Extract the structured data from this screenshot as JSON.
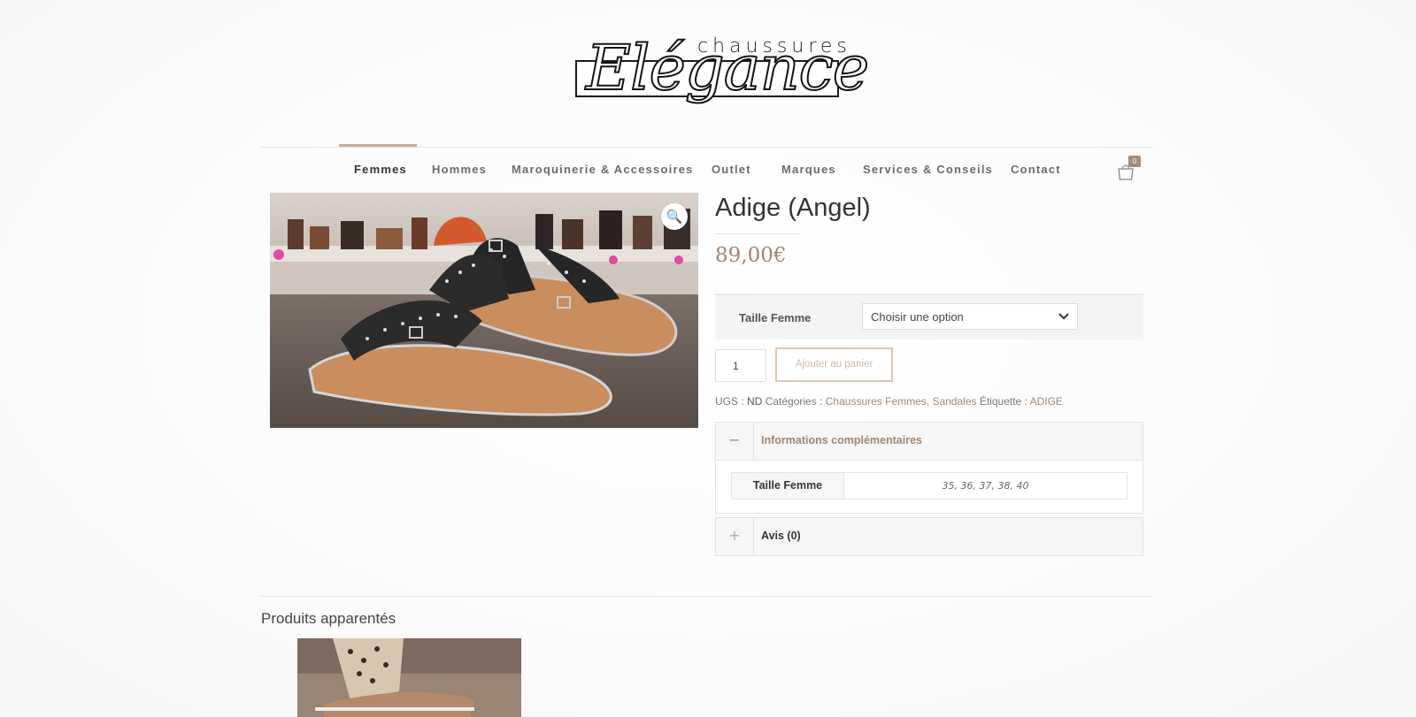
{
  "brand": {
    "logo_top": "chaussures",
    "logo_script": "Elégance"
  },
  "nav": {
    "items": [
      {
        "label": "Femmes",
        "active": true
      },
      {
        "label": "Hommes"
      },
      {
        "label": "Maroquinerie & Accessoires"
      },
      {
        "label": "Outlet"
      },
      {
        "label": "Marques"
      },
      {
        "label": "Services & Conseils"
      },
      {
        "label": "Contact"
      }
    ],
    "cart_count": "0",
    "cart_icon": "shopping-bag-icon"
  },
  "product": {
    "title": "Adige (Angel)",
    "price": "89,00€",
    "zoom_icon": "🔍",
    "variation_label": "Taille Femme",
    "variation_selected": "Choisir une option",
    "quantity": "1",
    "add_to_cart_label": "Ajouter au panier",
    "meta": {
      "sku_label": "UGS :",
      "sku_value": "ND",
      "categories_label": "Catégories :",
      "categories_value": "Chaussures Femmes, Sandales",
      "tag_label": "Étiquette :",
      "tag_value": "ADIGE"
    }
  },
  "tabs": {
    "info": {
      "toggle": "−",
      "title": "Informations complémentaires",
      "attr_name": "Taille Femme",
      "attr_value": "35, 36, 37, 38, 40"
    },
    "reviews": {
      "toggle": "+",
      "title": "Avis (0)"
    }
  },
  "related": {
    "title": "Produits apparentés"
  },
  "colors": {
    "accent": "#a08670",
    "nav_active_bar": "#c9ad93",
    "badge": "#a38c79"
  }
}
